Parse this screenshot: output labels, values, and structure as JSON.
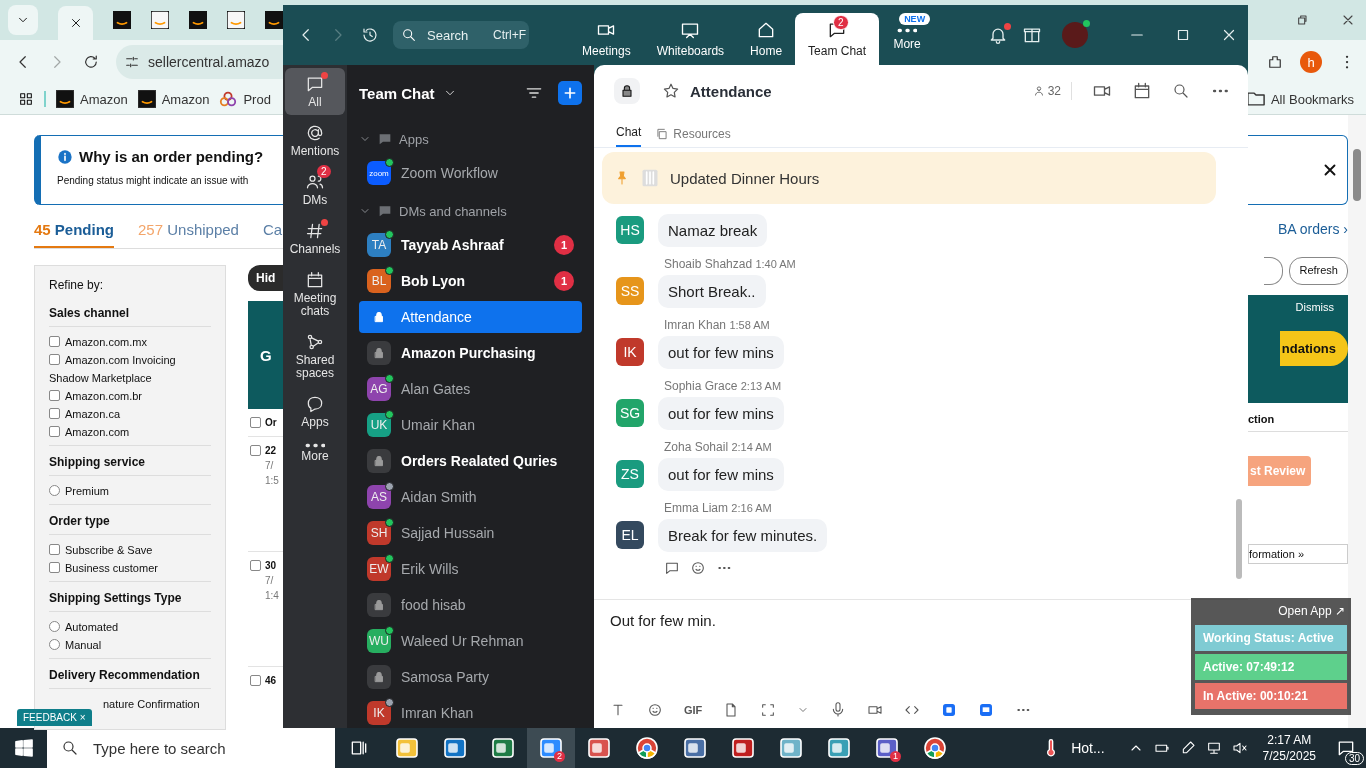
{
  "browser": {
    "url": "sellercentral.amazo",
    "bookmarks": [
      {
        "kind": "amazon",
        "label": "Amazon"
      },
      {
        "kind": "amazon",
        "label": "Amazon"
      },
      {
        "kind": "product",
        "label": "Prod"
      }
    ],
    "all_bookmarks": "All Bookmarks",
    "profile": "h"
  },
  "seller": {
    "notice": {
      "title": "Why is an order pending?",
      "text": "Pending status might indicate an issue with"
    },
    "order_tabs": [
      {
        "count": "45",
        "label": "Pending",
        "selected": true
      },
      {
        "count": "257",
        "label": "Unshipped",
        "selected": false
      },
      {
        "label": "Ca",
        "selected": false
      }
    ],
    "refine": {
      "title": "Refine by:",
      "groups": [
        {
          "title": "Sales channel",
          "options": [
            {
              "kind": "checkbox",
              "label": "Amazon.com.mx",
              "checked": false
            },
            {
              "kind": "checkbox",
              "label": "Amazon.com Invoicing Shadow Marketplace",
              "checked": false
            },
            {
              "kind": "checkbox",
              "label": "Amazon.com.br",
              "checked": false
            },
            {
              "kind": "checkbox",
              "label": "Amazon.ca",
              "checked": false
            },
            {
              "kind": "checkbox",
              "label": "Amazon.com",
              "checked": false
            }
          ]
        },
        {
          "title": "Shipping service",
          "options": [
            {
              "kind": "radio",
              "label": "Premium",
              "checked": false
            }
          ]
        },
        {
          "title": "Order type",
          "options": [
            {
              "kind": "checkbox",
              "label": "Subscribe & Save",
              "checked": false
            },
            {
              "kind": "checkbox",
              "label": "Business customer",
              "checked": false
            }
          ]
        },
        {
          "title": "Shipping Settings Type",
          "options": [
            {
              "kind": "radio",
              "label": "Automated",
              "checked": false
            },
            {
              "kind": "radio",
              "label": "Manual",
              "checked": false
            }
          ]
        },
        {
          "title": "Delivery Recommendation",
          "options": [
            {
              "kind": "text",
              "label": "nature Confirmation"
            }
          ]
        }
      ]
    },
    "feedback": {
      "label": "FEEDBACK",
      "close": "×"
    },
    "hide_button": "Hid",
    "banner_letter": "G",
    "orders_header": {
      "label": "Or",
      "checked": false
    },
    "orders": [
      {
        "id": "22",
        "date": "7/",
        "time": "1:5",
        "checked": false
      },
      {
        "id": "30",
        "date": "7/",
        "time": "1:4",
        "checked": false
      },
      {
        "id": "46",
        "checked": false
      }
    ],
    "fba_link": "BA orders ›",
    "refresh": "Refresh",
    "dismiss": "Dismiss",
    "cta": "ndations",
    "column_2": "ction",
    "review_button": "st Review",
    "info_button": "formation »"
  },
  "zoom": {
    "search": {
      "placeholder": "Search",
      "shortcut": "Ctrl+F"
    },
    "nav": [
      {
        "kind": "video",
        "label": "Meetings",
        "selected": false
      },
      {
        "kind": "whiteboard",
        "label": "Whiteboards",
        "selected": false
      },
      {
        "kind": "home",
        "label": "Home",
        "selected": false
      },
      {
        "kind": "chat",
        "label": "Team Chat",
        "selected": true,
        "badge": "2"
      },
      {
        "kind": "dots",
        "label": "More",
        "selected": false,
        "tag": "NEW"
      }
    ],
    "rail": [
      {
        "kind": "chat",
        "label": "All",
        "selected": true,
        "dot": true
      },
      {
        "kind": "at",
        "label": "Mentions",
        "selected": false,
        "dot": false
      },
      {
        "kind": "people",
        "label": "DMs",
        "selected": false,
        "dot": false,
        "badge": "2"
      },
      {
        "kind": "hash",
        "label": "Channels",
        "selected": false,
        "dot": true
      },
      {
        "kind": "calendar",
        "label": "Meeting chats",
        "selected": false,
        "dot": false
      },
      {
        "kind": "share",
        "label": "Shared spaces",
        "selected": false,
        "dot": false
      },
      {
        "kind": "bubble",
        "label": "Apps",
        "selected": false,
        "dot": false
      },
      {
        "kind": "dots",
        "label": "More",
        "selected": false,
        "dot": false
      }
    ],
    "list_title": "Team Chat",
    "sections": [
      {
        "title": "Apps",
        "expanded": true,
        "items": [
          {
            "kind": "app",
            "name": "Zoom Workflow",
            "logo": "zoom",
            "online": true,
            "bold": false,
            "selected": false
          }
        ]
      },
      {
        "title": "DMs and channels",
        "expanded": true,
        "items": [
          {
            "kind": "person",
            "initials": "TA",
            "color": "#2d7fc1",
            "name": "Tayyab Ashraaf",
            "online": true,
            "bold": true,
            "badge": "1",
            "selected": false
          },
          {
            "kind": "person",
            "initials": "BL",
            "color": "#d9621e",
            "name": "Bob Lyon",
            "online": true,
            "bold": true,
            "badge": "1",
            "selected": false
          },
          {
            "kind": "channel",
            "name": "Attendance",
            "bold": false,
            "selected": true
          },
          {
            "kind": "channel",
            "name": "Amazon Purchasing",
            "bold": true,
            "selected": false
          },
          {
            "kind": "person",
            "initials": "AG",
            "color": "#8e44ad",
            "name": "Alan Gates",
            "online": true,
            "bold": false,
            "selected": false
          },
          {
            "kind": "person",
            "initials": "UK",
            "color": "#16a085",
            "name": "Umair Khan",
            "online": true,
            "bold": false,
            "selected": false
          },
          {
            "kind": "channel",
            "name": "Orders Realated Quries",
            "bold": true,
            "selected": false
          },
          {
            "kind": "person",
            "initials": "AS",
            "color": "#8e44ad",
            "name": "Aidan Smith",
            "online": false,
            "bold": false,
            "selected": false
          },
          {
            "kind": "person",
            "initials": "SH",
            "color": "#c0392b",
            "name": "Sajjad Hussain",
            "online": true,
            "bold": false,
            "selected": false
          },
          {
            "kind": "person",
            "initials": "EW",
            "color": "#c0392b",
            "name": "Erik Wills",
            "online": true,
            "bold": false,
            "selected": false
          },
          {
            "kind": "channel",
            "name": "food hisab",
            "bold": false,
            "selected": false
          },
          {
            "kind": "person",
            "initials": "WU",
            "color": "#27ae60",
            "name": "Waleed Ur Rehman",
            "online": true,
            "bold": false,
            "selected": false
          },
          {
            "kind": "channel",
            "name": "Samosa Party",
            "bold": false,
            "selected": false
          },
          {
            "kind": "person",
            "initials": "IK",
            "color": "#c0392b",
            "name": "Imran Khan",
            "online": false,
            "bold": false,
            "selected": false
          }
        ]
      }
    ],
    "channel": {
      "title": "Attendance",
      "members": "32",
      "tabs": [
        {
          "label": "Chat",
          "selected": true
        },
        {
          "label": "Resources",
          "selected": false
        }
      ],
      "pinned": "Updated Dinner Hours",
      "messages": [
        {
          "initials": "HS",
          "color": "#1a9b7f",
          "text": "Namaz break"
        },
        {
          "initials": "SS",
          "color": "#e6951b",
          "sender": "Shoaib Shahzad",
          "time": "1:40 AM",
          "text": "Short Break.."
        },
        {
          "initials": "IK",
          "color": "#c0392b",
          "sender": "Imran Khan",
          "time": "1:58 AM",
          "text": "out for few mins"
        },
        {
          "initials": "SG",
          "color": "#22a56a",
          "sender": "Sophia Grace",
          "time": "2:13 AM",
          "text": "out for few mins"
        },
        {
          "initials": "ZS",
          "color": "#1a9b7f",
          "sender": "Zoha Sohail",
          "time": "2:14 AM",
          "text": "out for few mins"
        },
        {
          "initials": "EL",
          "color": "#34495e",
          "sender": "Emma Liam",
          "time": "2:16 AM",
          "text": "Break for few minutes."
        }
      ],
      "composer": {
        "value": "Out for few min.",
        "gif": "GIF"
      }
    }
  },
  "tracker": {
    "open_app": "Open App ↗",
    "rows": [
      {
        "label": "Working Status: Active",
        "color": "#7fcbd3"
      },
      {
        "label": "Active: 07:49:12",
        "color": "#5ed08c"
      },
      {
        "label": "In Active: 00:10:21",
        "color": "#e8736a"
      }
    ]
  },
  "taskbar": {
    "search": {
      "placeholder": "Type here to search"
    },
    "apps": [
      {
        "kind": "taskview",
        "selected": false
      },
      {
        "kind": "folder",
        "selected": false
      },
      {
        "kind": "outlook",
        "selected": false
      },
      {
        "kind": "excel",
        "selected": false
      },
      {
        "kind": "zoom",
        "selected": true,
        "badge": "2"
      },
      {
        "kind": "paint",
        "selected": false
      },
      {
        "kind": "chrome",
        "selected": false
      },
      {
        "kind": "calc",
        "selected": false
      },
      {
        "kind": "filezilla",
        "selected": false
      },
      {
        "kind": "notes",
        "selected": false
      },
      {
        "kind": "cube",
        "selected": false
      },
      {
        "kind": "teams",
        "selected": false,
        "badge": "1"
      },
      {
        "kind": "chrome",
        "selected": false
      }
    ],
    "weather": "Hot...",
    "time": "2:17 AM",
    "date": "7/25/2025",
    "notifications": "30"
  }
}
